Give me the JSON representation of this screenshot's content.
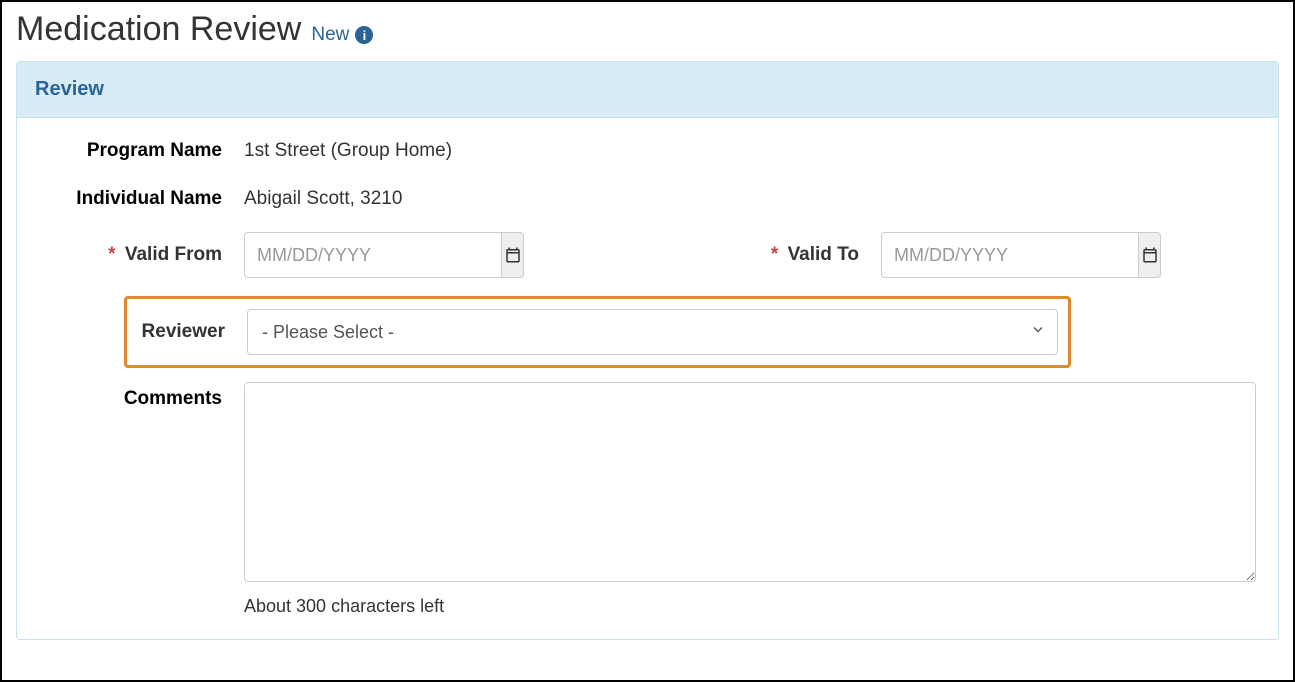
{
  "header": {
    "title": "Medication Review",
    "status_label": "New"
  },
  "panel": {
    "title": "Review"
  },
  "form": {
    "program_name": {
      "label": "Program Name",
      "value": "1st Street (Group Home)"
    },
    "individual_name": {
      "label": "Individual Name",
      "value": "Abigail Scott, 3210"
    },
    "valid_from": {
      "label": "Valid From",
      "placeholder": "MM/DD/YYYY",
      "value": ""
    },
    "valid_to": {
      "label": "Valid To",
      "placeholder": "MM/DD/YYYY",
      "value": ""
    },
    "reviewer": {
      "label": "Reviewer",
      "selected": "- Please Select -"
    },
    "comments": {
      "label": "Comments",
      "value": "",
      "char_note": "About 300 characters left"
    }
  }
}
